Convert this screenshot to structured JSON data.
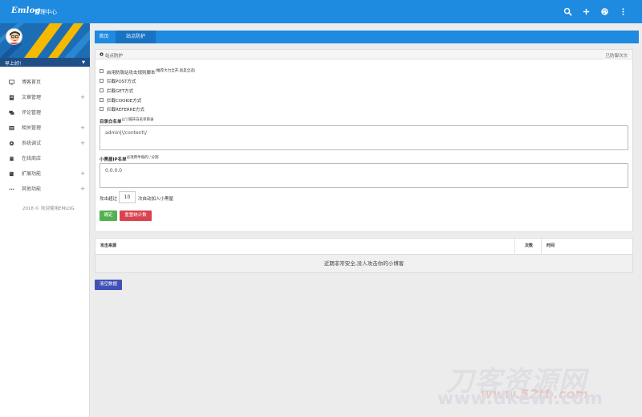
{
  "header": {
    "logo": "Emlog",
    "subtitle": "管理中心",
    "icons": [
      "search-icon",
      "plus-icon",
      "palette-icon",
      "more-vertical-icon"
    ]
  },
  "sidebar": {
    "greeting": "早上好!",
    "items": [
      {
        "label": "博客首页",
        "icon": "monitor-icon",
        "expandable": false
      },
      {
        "label": "文章管理",
        "icon": "document-icon",
        "expandable": true
      },
      {
        "label": "评论管理",
        "icon": "comments-icon",
        "expandable": false
      },
      {
        "label": "相关管理",
        "icon": "list-icon",
        "expandable": true
      },
      {
        "label": "系统调试",
        "icon": "gear-icon",
        "expandable": true
      },
      {
        "label": "在线商店",
        "icon": "store-icon",
        "expandable": false
      },
      {
        "label": "扩展功能",
        "icon": "puzzle-icon",
        "expandable": true
      },
      {
        "label": "其他功能",
        "icon": "dots-icon",
        "expandable": true
      }
    ],
    "plus_symbol": "+",
    "copyright": "2018 © 欢迎使用EMLOG"
  },
  "tabs": [
    {
      "label": "首页",
      "active": false
    },
    {
      "label": "站点防护",
      "active": true
    }
  ],
  "panel": {
    "title": "站点防护",
    "right_text": "已防御次次",
    "checkboxes": [
      {
        "label": "启用防陇站攻击规则脚本",
        "note": "(推荐大力全开,就是全选)"
      },
      {
        "label": "拦截POST方式",
        "note": ""
      },
      {
        "label": "拦截GET方式",
        "note": ""
      },
      {
        "label": "拦截COOKIE方式",
        "note": ""
      },
      {
        "label": "拦截REFERRE方式",
        "note": ""
      }
    ],
    "whitelist_dir_label": "目录白名单",
    "whitelist_dir_note": "以'|'隔开白名单目录",
    "whitelist_dir_value": "admin|\\/content\\/",
    "ip_whitelist_label": "小黑屋IP名单",
    "ip_whitelist_note": "必须用半角的','分割",
    "ip_whitelist_value": "0.0.0.0",
    "attack_prefix": "攻击超过",
    "attack_count": "10",
    "attack_suffix": "次自动加入小黑屋",
    "ok_button": "确定",
    "reset_button": "重置统计数"
  },
  "table": {
    "columns": [
      "攻击来源",
      "次数",
      "时间"
    ],
    "empty_message": "近期非常安全,没人攻击你的小博客"
  },
  "clear_button": "清空数据",
  "watermark": {
    "line1": "刀客资源网",
    "line2": "www.dkewl.com",
    "line3": "www.52tb.com"
  },
  "colors": {
    "primary": "#1e8ae0",
    "tab_active": "#1873c4",
    "ok": "#52b152",
    "danger": "#d9434e",
    "clear": "#3f51b5"
  }
}
